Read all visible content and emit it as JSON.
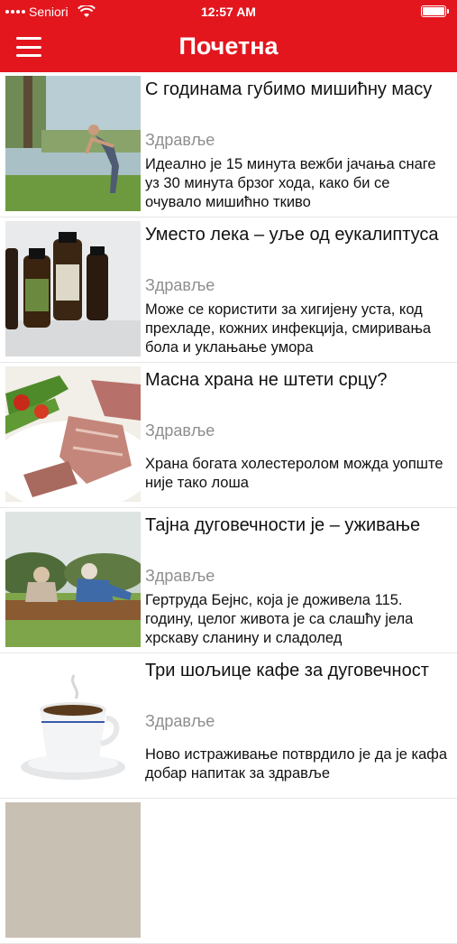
{
  "status_bar": {
    "carrier": "Seniori",
    "time": "12:57 AM"
  },
  "header": {
    "title": "Почетна",
    "menu_icon": "hamburger-menu-icon"
  },
  "articles": [
    {
      "title": "С годинама губимо мишићну масу",
      "category": "Здравље",
      "excerpt": "Идеално је 15 минута вежби јачања снаге уз 30 минута брзог хода, како би се очувало мишићно ткиво"
    },
    {
      "title": "Уместо лека – уље од еукалиптуса",
      "category": "Здравље",
      "excerpt": "Може се користити за хигијену уста, код прехладе, кожних инфекција, смиривања бола и уклањање умора"
    },
    {
      "title": "Масна храна не штети срцу?",
      "category": "Здравље",
      "excerpt": "Храна богата холестеролом можда уопште није тако лоша"
    },
    {
      "title": "Тајна дуговечности је – уживање",
      "category": "Здравље",
      "excerpt": "Гертруда Бејнс, која је доживела 115. годину, целог живота је са слашћу јела хрскаву сланину и сладолед"
    },
    {
      "title": "Три шољице кафе за дуговечност",
      "category": "Здравље",
      "excerpt": "Ново истраживање потврдило је да је кафа добар напитак за здравље"
    },
    {
      "title": "",
      "category": "",
      "excerpt": ""
    }
  ],
  "colors": {
    "accent": "#e3161e",
    "category": "#8e8e8e"
  }
}
